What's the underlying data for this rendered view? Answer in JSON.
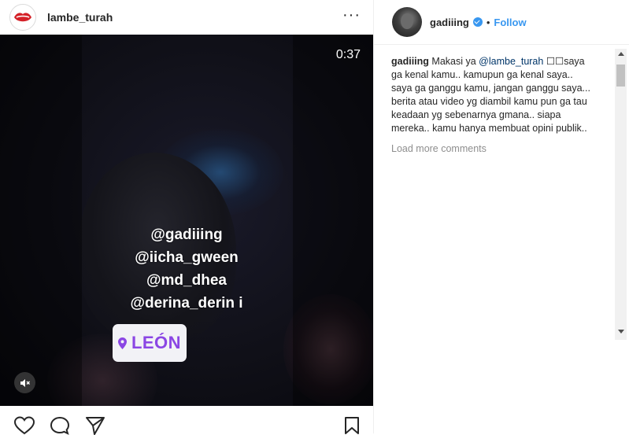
{
  "post": {
    "username": "lambe_turah",
    "more_label": "···",
    "video": {
      "duration": "0:37",
      "tags": [
        "@gadiiing",
        "@iicha_gween",
        "@md_dhea",
        "@derina_derin i"
      ],
      "location": "LEÓN"
    }
  },
  "sidebar": {
    "username": "gadiiing",
    "separator": "•",
    "follow_label": "Follow",
    "comment": {
      "user": "gadiiing",
      "text_before": "Makasi ya ",
      "mention": "@lambe_turah",
      "text_after": " ☐☐saya ga kenal kamu.. kamupun ga kenal saya.. saya ga ganggu kamu, jangan ganggu saya... berita atau video yg diambil kamu pun ga tau keadaan yg sebenarnya gmana.. siapa mereka.. kamu hanya membuat opini publik.."
    },
    "load_more": "Load more comments"
  },
  "icons": {
    "avatar_left": "lips-logo-icon",
    "verified": "verified-badge-icon",
    "mute": "speaker-muted-icon",
    "like": "heart-icon",
    "comment": "comment-bubble-icon",
    "share": "paper-plane-icon",
    "save": "bookmark-icon",
    "location": "location-pin-icon"
  },
  "colors": {
    "accent": "#3897f0",
    "location_text": "#8b46e4",
    "text": "#262626",
    "muted": "#8e8e8e"
  }
}
